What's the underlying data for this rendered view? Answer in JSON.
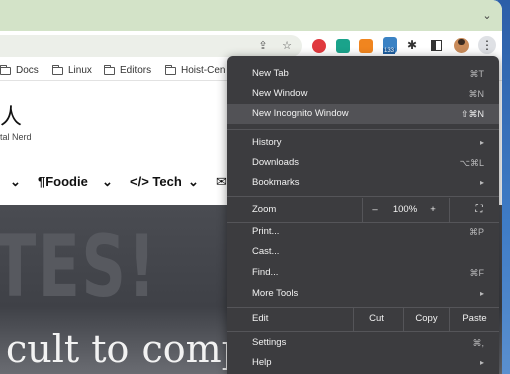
{
  "tabstrip": {
    "menu_icon": "chevron-down-icon"
  },
  "toolbar": {
    "icons": [
      "share-icon",
      "bookmark-star-icon"
    ],
    "extensions": [
      {
        "name": "ext-circle-icon",
        "color": "#e0393e"
      },
      {
        "name": "ext-green-icon",
        "color": "#1aa38b"
      },
      {
        "name": "ext-rss-icon",
        "color": "#f0851f"
      },
      {
        "name": "ext-badge-icon",
        "color": "#3b82c4",
        "badge": "133"
      }
    ],
    "puzzle_icon": "puzzle-extensions-icon",
    "sidepanel_icon": "side-panel-icon",
    "avatar": "profile-avatar",
    "kebab_icon": "vertical-dots-menu-icon"
  },
  "bookmarks": [
    "Docs",
    "Linux",
    "Editors",
    "Hoist-Cen"
  ],
  "page": {
    "title_glyph": "人",
    "tagline": "tal Nerd",
    "nav": {
      "foodie": "Foodie",
      "tech": "Tech"
    },
    "hero_letters": "TES!",
    "hero_headline": "cult to complet"
  },
  "menu": {
    "items": [
      {
        "label": "New Tab",
        "shortcut": "⌘T"
      },
      {
        "label": "New Window",
        "shortcut": "⌘N"
      },
      {
        "label": "New Incognito Window",
        "shortcut": "⇧⌘N"
      },
      {
        "label": "History"
      },
      {
        "label": "Downloads",
        "shortcut": "⌥⌘L"
      },
      {
        "label": "Bookmarks"
      },
      {
        "label": "Print...",
        "shortcut": "⌘P"
      },
      {
        "label": "Cast..."
      },
      {
        "label": "Find...",
        "shortcut": "⌘F"
      },
      {
        "label": "More Tools"
      },
      {
        "label": "Settings",
        "shortcut": "⌘,"
      },
      {
        "label": "Help"
      }
    ],
    "zoom": {
      "label": "Zoom",
      "minus": "–",
      "value": "100%",
      "plus": "+"
    },
    "edit": {
      "label": "Edit",
      "cut": "Cut",
      "copy": "Copy",
      "paste": "Paste"
    }
  }
}
